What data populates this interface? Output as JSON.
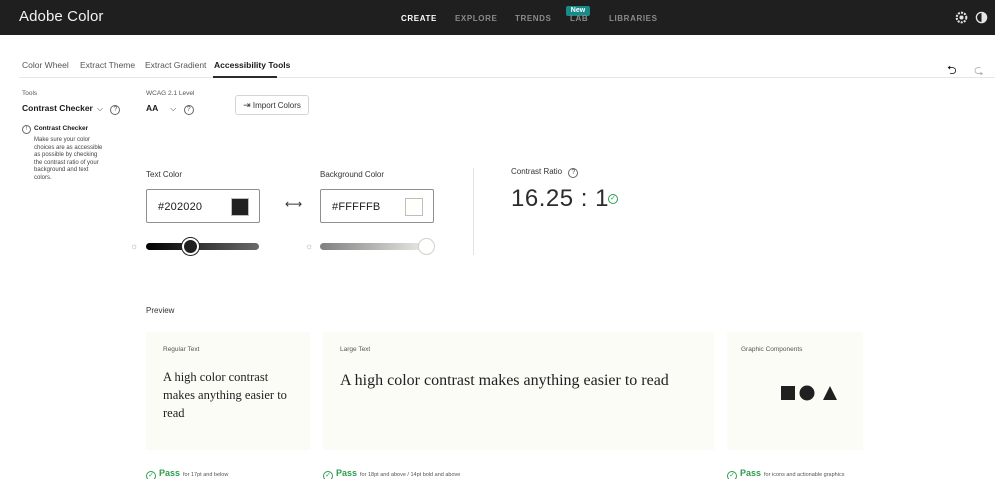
{
  "app": {
    "title": "Adobe Color"
  },
  "nav": {
    "items": [
      {
        "label": "CREATE",
        "active": true
      },
      {
        "label": "EXPLORE",
        "active": false
      },
      {
        "label": "TRENDS",
        "active": false
      },
      {
        "label": "LAB",
        "active": false
      },
      {
        "label": "LIBRARIES",
        "active": false
      }
    ],
    "lab_badge": "New",
    "icons": [
      "settings-icon",
      "theme-icon"
    ]
  },
  "tabs": [
    {
      "label": "Color Wheel",
      "active": false
    },
    {
      "label": "Extract Theme",
      "active": false
    },
    {
      "label": "Extract Gradient",
      "active": false
    },
    {
      "label": "Accessibility Tools",
      "active": true
    }
  ],
  "tools": {
    "label": "Tools",
    "selected": "Contrast Checker",
    "info_title": "Contrast Checker",
    "info_text": "Make sure your color choices are as accessible as possible by checking the contrast ratio of your background and text colors."
  },
  "wcag": {
    "label": "WCAG 2.1 Level",
    "selected": "AA"
  },
  "import_button": "Import Colors",
  "text_color": {
    "label": "Text Color",
    "value": "#202020",
    "swatch": "#202020",
    "brightness": 0.35
  },
  "background_color": {
    "label": "Background Color",
    "value": "#FFFFFB",
    "swatch": "#FFFFFB",
    "brightness": 1.0
  },
  "contrast": {
    "label": "Contrast Ratio",
    "value": "16.25 : 1"
  },
  "preview": {
    "label": "Preview",
    "regular": {
      "caption": "Regular Text",
      "sample": "A high color contrast makes anything easier to read"
    },
    "large": {
      "caption": "Large Text",
      "sample": "A high color contrast makes anything easier to read"
    },
    "graphic": {
      "caption": "Graphic Components"
    }
  },
  "results": [
    {
      "status": "Pass",
      "detail": "for 17pt and below"
    },
    {
      "status": "Pass",
      "detail": "for 18pt and above / 14pt bold and above"
    },
    {
      "status": "Pass",
      "detail": "for icons and actionable graphics"
    }
  ],
  "colors": {
    "accent": "#2d9d4e",
    "topbar": "#1f1f1f",
    "badge": "#178a8a"
  }
}
